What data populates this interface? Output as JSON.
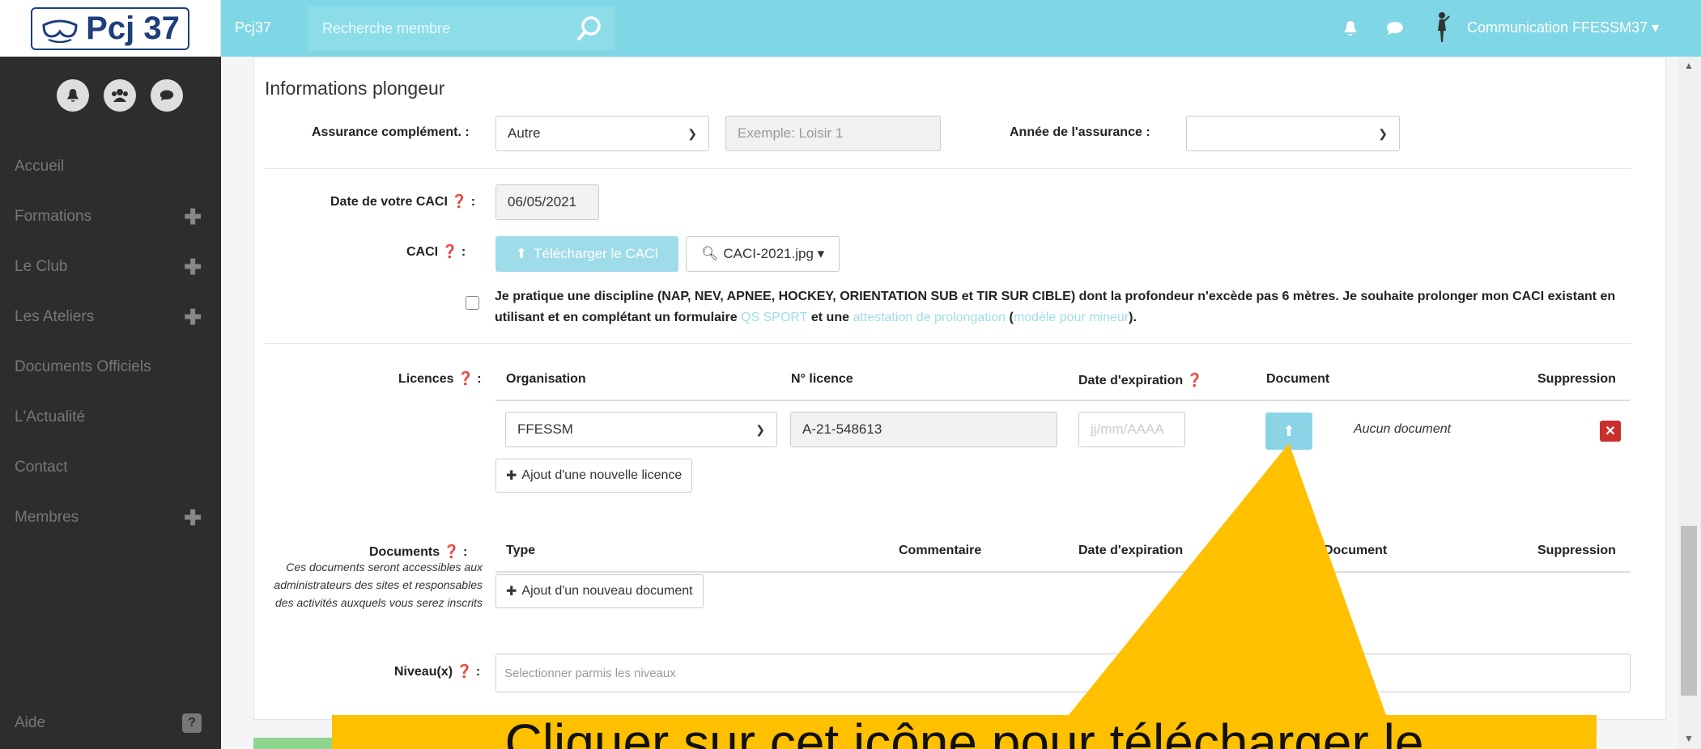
{
  "topbar": {
    "logo_text": "Pcj 37",
    "brand": "Pcj37",
    "search_placeholder": "Recherche membre",
    "user_name": "Communication FFESSM37 ▾",
    "icons": [
      "bell-icon",
      "chat-icon",
      "diver-icon"
    ],
    "bg_color": "#7fd6e4"
  },
  "sidebar": {
    "items": [
      {
        "label": "Accueil",
        "expandable": false
      },
      {
        "label": "Formations",
        "expandable": true
      },
      {
        "label": "Le Club",
        "expandable": true
      },
      {
        "label": "Les Ateliers",
        "expandable": true
      },
      {
        "label": "Documents Officiels",
        "expandable": false
      },
      {
        "label": "L'Actualité",
        "expandable": false
      },
      {
        "label": "Contact",
        "expandable": false
      },
      {
        "label": "Membres",
        "expandable": true
      }
    ],
    "help_label": "Aide",
    "plus": "✚"
  },
  "form": {
    "section_title": "Informations plongeur",
    "assurance": {
      "label": "Assurance complément. :",
      "value": "Autre",
      "other_placeholder": "Exemple: Loisir 1",
      "year_label": "Année de l'assurance :",
      "year_value": ""
    },
    "caci": {
      "date_label": "Date de votre CACI",
      "date_value": "06/05/2021",
      "caci_label": "CACI",
      "upload_button": "Télécharger le CACI",
      "file_button": "CACI-2021.jpg ▾",
      "checkbox_text_1": "Je pratique une discipline (NAP, NEV, APNEE, HOCKEY, ORIENTATION SUB et TIR SUR CIBLE) dont la profondeur n'excède pas 6 mètres. Je souhaite prolonger mon CACI existant en utilisant et en complétant un formulaire ",
      "link_qs_sport": "QS SPORT",
      "checkbox_text_2": " et une ",
      "link_attestation": "attestation de prolongation",
      "checkbox_text_3": " (",
      "link_mineur": "modèle pour mineur",
      "checkbox_text_4": ")."
    },
    "licences": {
      "label": "Licences",
      "headers": [
        "Organisation",
        "N° licence",
        "Date d'expiration",
        "Document",
        "Suppression"
      ],
      "rows": [
        {
          "organisation": "FFESSM",
          "numero": "A-21-548613",
          "date_placeholder": "jj/mm/AAAA",
          "document": "Aucun document"
        }
      ],
      "add_button": "Ajout d'une nouvelle licence"
    },
    "documents": {
      "label": "Documents",
      "note": "Ces documents seront accessibles aux administrateurs des sites et responsables des activités auxquels vous serez inscrits",
      "headers": [
        "Type",
        "Commentaire",
        "Date d'expiration",
        "Document",
        "Suppression"
      ],
      "add_button": "Ajout d'un nouveau document"
    },
    "niveaux": {
      "label": "Niveau(x)",
      "placeholder": "Selectionner parmis les niveaux"
    }
  },
  "annotation": {
    "text": "Cliquer sur cet icône pour télécharger le",
    "color": "#ffc000"
  }
}
